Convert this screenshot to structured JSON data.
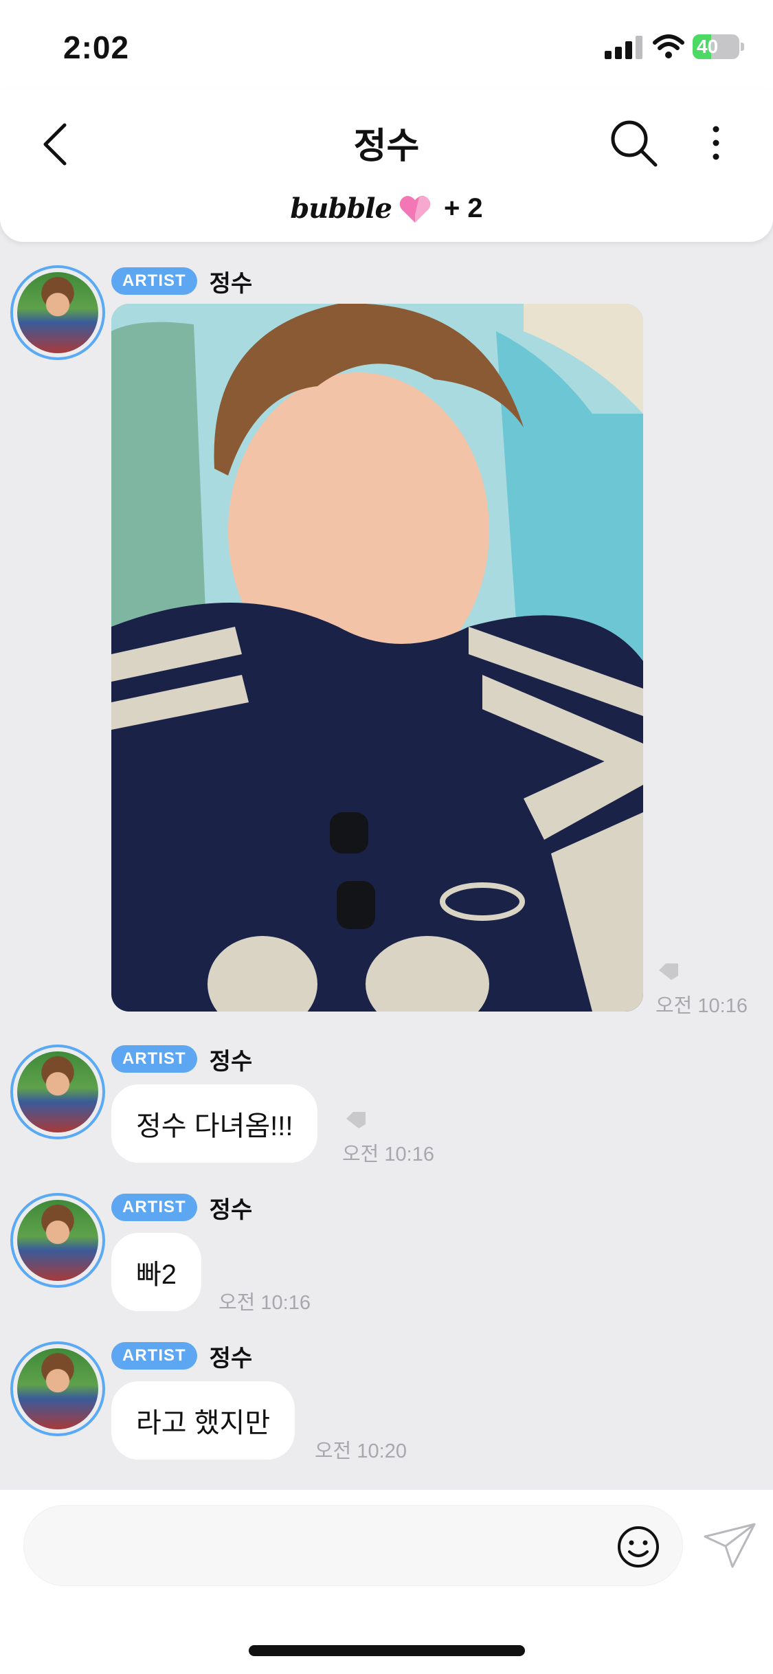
{
  "status": {
    "time": "2:02",
    "battery": "40"
  },
  "header": {
    "title": "정수",
    "brand": "bubble",
    "extra_count": "+ 2"
  },
  "messages": [
    {
      "badge": "ARTIST",
      "sender": "정수",
      "type": "image",
      "time": "오전 10:16"
    },
    {
      "badge": "ARTIST",
      "sender": "정수",
      "text": "정수 다녀옴!!!",
      "time": "오전 10:16"
    },
    {
      "badge": "ARTIST",
      "sender": "정수",
      "text": "빠2",
      "time": "오전 10:16"
    },
    {
      "badge": "ARTIST",
      "sender": "정수",
      "text": "라고 했지만",
      "time": "오전 10:20"
    }
  ],
  "colors": {
    "accent": "#5ca6f2",
    "background": "#ececee",
    "heart": "#f277b4",
    "battery": "#4cd964"
  },
  "icons": [
    "back-arrow-icon",
    "search-icon",
    "more-vertical-icon",
    "heart-icon",
    "emoji-icon",
    "send-icon",
    "tag-icon"
  ]
}
